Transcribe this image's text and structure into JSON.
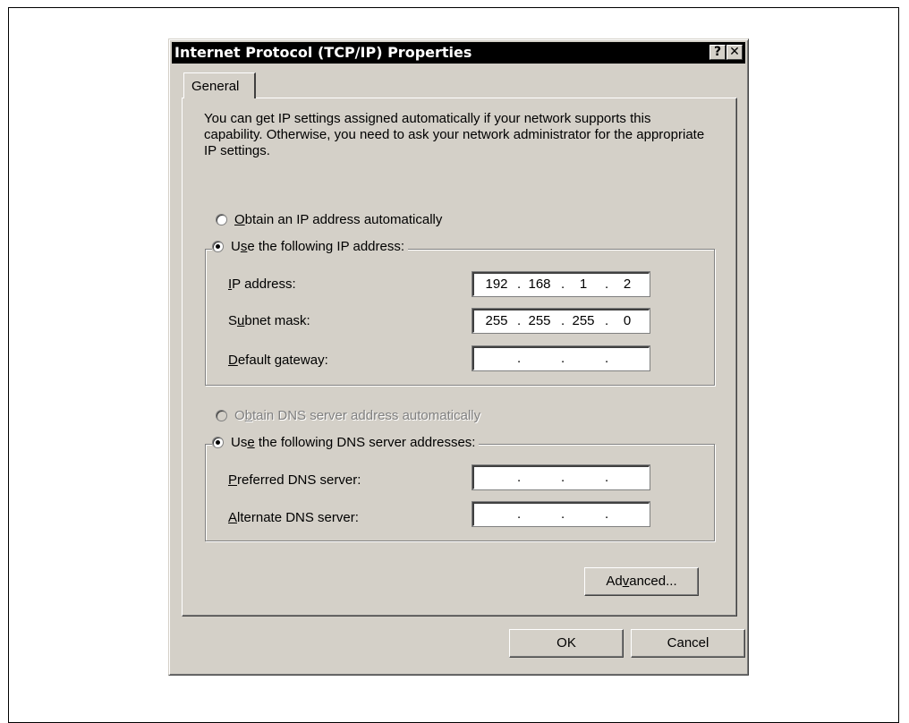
{
  "dialog": {
    "title": "Internet Protocol (TCP/IP) Properties",
    "help_label": "?",
    "close_label": "✕"
  },
  "tab": {
    "label": "General"
  },
  "description": "You can get IP settings assigned automatically if your network supports this capability. Otherwise, you need to ask your network administrator for the appropriate IP settings.",
  "ip": {
    "auto_option": {
      "prefix": "",
      "accel": "O",
      "rest": "btain an IP address automatically",
      "checked": false
    },
    "manual_option": {
      "prefix": "U",
      "accel": "s",
      "rest": "e the following IP address:",
      "checked": true
    },
    "fields": [
      {
        "pre": "",
        "accel": "I",
        "post": "P address:",
        "octets": [
          "192",
          "168",
          "1",
          "2"
        ]
      },
      {
        "pre": "S",
        "accel": "u",
        "post": "bnet mask:",
        "octets": [
          "255",
          "255",
          "255",
          "0"
        ]
      },
      {
        "pre": "",
        "accel": "D",
        "post": "efault gateway:",
        "octets": [
          "",
          "",
          "",
          ""
        ]
      }
    ]
  },
  "dns": {
    "auto_option": {
      "prefix": "O",
      "accel": "b",
      "rest": "tain DNS server address automatically",
      "checked": false,
      "disabled": true
    },
    "manual_option": {
      "prefix": "Us",
      "accel": "e",
      "rest": " the following DNS server addresses:",
      "checked": true
    },
    "fields": [
      {
        "pre": "",
        "accel": "P",
        "post": "referred DNS server:",
        "octets": [
          "",
          "",
          "",
          ""
        ]
      },
      {
        "pre": "",
        "accel": "A",
        "post": "lternate DNS server:",
        "octets": [
          "",
          "",
          "",
          ""
        ]
      }
    ]
  },
  "buttons": {
    "advanced": {
      "pre": "Ad",
      "accel": "v",
      "post": "anced..."
    },
    "ok": "OK",
    "cancel": "Cancel"
  },
  "icons": {
    "radio": "radio-button-icon"
  }
}
